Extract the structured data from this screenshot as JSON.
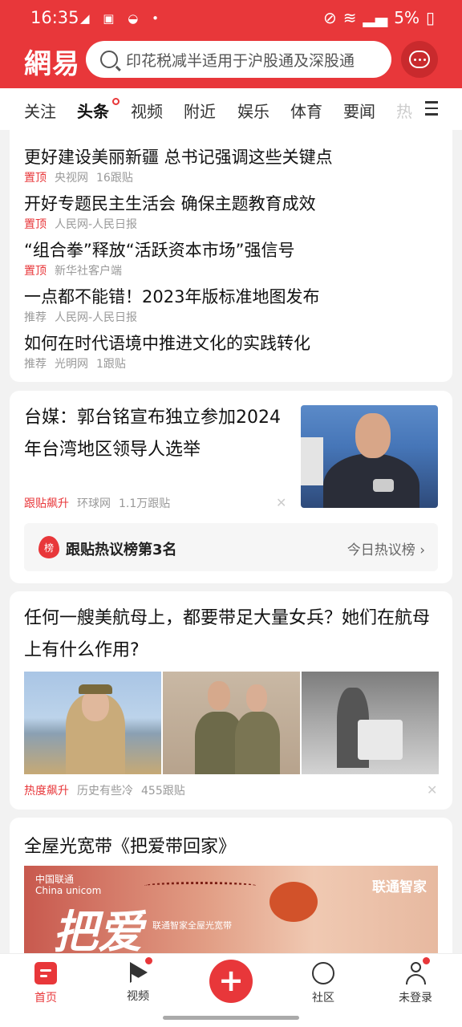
{
  "status_bar": {
    "time": "16:35",
    "battery": "5%"
  },
  "header": {
    "logo": "網易",
    "search_placeholder": "印花税减半适用于沪股通及深股通",
    "icons": [
      "search-icon",
      "message-icon"
    ]
  },
  "tabs": [
    "关注",
    "头条",
    "视频",
    "附近",
    "娱乐",
    "体育",
    "要闻",
    "热"
  ],
  "top_news": [
    {
      "title": "更好建设美丽新疆 总书记强调这些关键点",
      "tag": "置顶",
      "source": "央视网",
      "comments": "16跟贴"
    },
    {
      "title": "开好专题民主生活会 确保主题教育成效",
      "tag": "置顶",
      "source": "人民网-人民日报",
      "comments": ""
    },
    {
      "title": "“组合拳”释放“活跃资本市场”强信号",
      "tag": "置顶",
      "source": "新华社客户端",
      "comments": ""
    },
    {
      "title": "一点都不能错！2023年版标准地图发布",
      "tag": "推荐",
      "source": "人民网-人民日报",
      "comments": ""
    },
    {
      "title": "如何在时代语境中推进文化的实践转化",
      "tag": "推荐",
      "source": "光明网",
      "comments": "1跟贴"
    }
  ],
  "card2": {
    "title": "台媒：郭台铭宣布独立参加2024年台湾地区领导人选举",
    "tag": "跟贴飙升",
    "source": "环球网",
    "comments": "1.1万跟贴",
    "hot_badge": "榜",
    "hot_label": "跟贴热议榜第3名",
    "hot_link": "今日热议榜"
  },
  "card3": {
    "title": "任何一艘美航母上，都要带足大量女兵？她们在航母上有什么作用?",
    "tag": "热度飙升",
    "source": "历史有些冷",
    "comments": "455跟贴"
  },
  "card4": {
    "title": "全屋光宽带《把爱带回家》",
    "banner_brand": "中国联通",
    "banner_brand_en": "China unicom",
    "banner_brand_right": "联通智家",
    "banner_big": "把爱",
    "banner_sub": "联通智家全屋光宽带"
  },
  "bottom_nav": [
    {
      "label": "首页",
      "icon": "home-icon",
      "active": true
    },
    {
      "label": "视频",
      "icon": "video-icon",
      "active": false
    },
    {
      "label": "",
      "icon": "plus-icon",
      "active": false
    },
    {
      "label": "社区",
      "icon": "community-icon",
      "active": false
    },
    {
      "label": "未登录",
      "icon": "user-icon",
      "active": false
    }
  ],
  "colors": {
    "brand": "#e8373a",
    "tag_red": "#e8373a"
  }
}
